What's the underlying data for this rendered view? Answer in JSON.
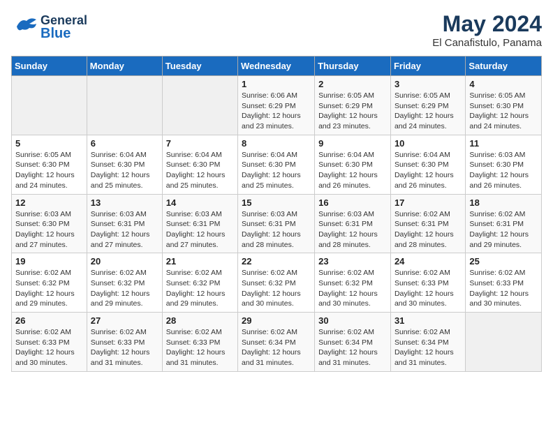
{
  "header": {
    "logo": {
      "line1": "General",
      "line2": "Blue"
    },
    "title": "May 2024",
    "location": "El Canafistulo, Panama"
  },
  "weekdays": [
    "Sunday",
    "Monday",
    "Tuesday",
    "Wednesday",
    "Thursday",
    "Friday",
    "Saturday"
  ],
  "weeks": [
    [
      {
        "day": "",
        "sunrise": "",
        "sunset": "",
        "daylight": ""
      },
      {
        "day": "",
        "sunrise": "",
        "sunset": "",
        "daylight": ""
      },
      {
        "day": "",
        "sunrise": "",
        "sunset": "",
        "daylight": ""
      },
      {
        "day": "1",
        "sunrise": "Sunrise: 6:06 AM",
        "sunset": "Sunset: 6:29 PM",
        "daylight": "Daylight: 12 hours and 23 minutes."
      },
      {
        "day": "2",
        "sunrise": "Sunrise: 6:05 AM",
        "sunset": "Sunset: 6:29 PM",
        "daylight": "Daylight: 12 hours and 23 minutes."
      },
      {
        "day": "3",
        "sunrise": "Sunrise: 6:05 AM",
        "sunset": "Sunset: 6:29 PM",
        "daylight": "Daylight: 12 hours and 24 minutes."
      },
      {
        "day": "4",
        "sunrise": "Sunrise: 6:05 AM",
        "sunset": "Sunset: 6:30 PM",
        "daylight": "Daylight: 12 hours and 24 minutes."
      }
    ],
    [
      {
        "day": "5",
        "sunrise": "Sunrise: 6:05 AM",
        "sunset": "Sunset: 6:30 PM",
        "daylight": "Daylight: 12 hours and 24 minutes."
      },
      {
        "day": "6",
        "sunrise": "Sunrise: 6:04 AM",
        "sunset": "Sunset: 6:30 PM",
        "daylight": "Daylight: 12 hours and 25 minutes."
      },
      {
        "day": "7",
        "sunrise": "Sunrise: 6:04 AM",
        "sunset": "Sunset: 6:30 PM",
        "daylight": "Daylight: 12 hours and 25 minutes."
      },
      {
        "day": "8",
        "sunrise": "Sunrise: 6:04 AM",
        "sunset": "Sunset: 6:30 PM",
        "daylight": "Daylight: 12 hours and 25 minutes."
      },
      {
        "day": "9",
        "sunrise": "Sunrise: 6:04 AM",
        "sunset": "Sunset: 6:30 PM",
        "daylight": "Daylight: 12 hours and 26 minutes."
      },
      {
        "day": "10",
        "sunrise": "Sunrise: 6:04 AM",
        "sunset": "Sunset: 6:30 PM",
        "daylight": "Daylight: 12 hours and 26 minutes."
      },
      {
        "day": "11",
        "sunrise": "Sunrise: 6:03 AM",
        "sunset": "Sunset: 6:30 PM",
        "daylight": "Daylight: 12 hours and 26 minutes."
      }
    ],
    [
      {
        "day": "12",
        "sunrise": "Sunrise: 6:03 AM",
        "sunset": "Sunset: 6:30 PM",
        "daylight": "Daylight: 12 hours and 27 minutes."
      },
      {
        "day": "13",
        "sunrise": "Sunrise: 6:03 AM",
        "sunset": "Sunset: 6:31 PM",
        "daylight": "Daylight: 12 hours and 27 minutes."
      },
      {
        "day": "14",
        "sunrise": "Sunrise: 6:03 AM",
        "sunset": "Sunset: 6:31 PM",
        "daylight": "Daylight: 12 hours and 27 minutes."
      },
      {
        "day": "15",
        "sunrise": "Sunrise: 6:03 AM",
        "sunset": "Sunset: 6:31 PM",
        "daylight": "Daylight: 12 hours and 28 minutes."
      },
      {
        "day": "16",
        "sunrise": "Sunrise: 6:03 AM",
        "sunset": "Sunset: 6:31 PM",
        "daylight": "Daylight: 12 hours and 28 minutes."
      },
      {
        "day": "17",
        "sunrise": "Sunrise: 6:02 AM",
        "sunset": "Sunset: 6:31 PM",
        "daylight": "Daylight: 12 hours and 28 minutes."
      },
      {
        "day": "18",
        "sunrise": "Sunrise: 6:02 AM",
        "sunset": "Sunset: 6:31 PM",
        "daylight": "Daylight: 12 hours and 29 minutes."
      }
    ],
    [
      {
        "day": "19",
        "sunrise": "Sunrise: 6:02 AM",
        "sunset": "Sunset: 6:32 PM",
        "daylight": "Daylight: 12 hours and 29 minutes."
      },
      {
        "day": "20",
        "sunrise": "Sunrise: 6:02 AM",
        "sunset": "Sunset: 6:32 PM",
        "daylight": "Daylight: 12 hours and 29 minutes."
      },
      {
        "day": "21",
        "sunrise": "Sunrise: 6:02 AM",
        "sunset": "Sunset: 6:32 PM",
        "daylight": "Daylight: 12 hours and 29 minutes."
      },
      {
        "day": "22",
        "sunrise": "Sunrise: 6:02 AM",
        "sunset": "Sunset: 6:32 PM",
        "daylight": "Daylight: 12 hours and 30 minutes."
      },
      {
        "day": "23",
        "sunrise": "Sunrise: 6:02 AM",
        "sunset": "Sunset: 6:32 PM",
        "daylight": "Daylight: 12 hours and 30 minutes."
      },
      {
        "day": "24",
        "sunrise": "Sunrise: 6:02 AM",
        "sunset": "Sunset: 6:33 PM",
        "daylight": "Daylight: 12 hours and 30 minutes."
      },
      {
        "day": "25",
        "sunrise": "Sunrise: 6:02 AM",
        "sunset": "Sunset: 6:33 PM",
        "daylight": "Daylight: 12 hours and 30 minutes."
      }
    ],
    [
      {
        "day": "26",
        "sunrise": "Sunrise: 6:02 AM",
        "sunset": "Sunset: 6:33 PM",
        "daylight": "Daylight: 12 hours and 30 minutes."
      },
      {
        "day": "27",
        "sunrise": "Sunrise: 6:02 AM",
        "sunset": "Sunset: 6:33 PM",
        "daylight": "Daylight: 12 hours and 31 minutes."
      },
      {
        "day": "28",
        "sunrise": "Sunrise: 6:02 AM",
        "sunset": "Sunset: 6:33 PM",
        "daylight": "Daylight: 12 hours and 31 minutes."
      },
      {
        "day": "29",
        "sunrise": "Sunrise: 6:02 AM",
        "sunset": "Sunset: 6:34 PM",
        "daylight": "Daylight: 12 hours and 31 minutes."
      },
      {
        "day": "30",
        "sunrise": "Sunrise: 6:02 AM",
        "sunset": "Sunset: 6:34 PM",
        "daylight": "Daylight: 12 hours and 31 minutes."
      },
      {
        "day": "31",
        "sunrise": "Sunrise: 6:02 AM",
        "sunset": "Sunset: 6:34 PM",
        "daylight": "Daylight: 12 hours and 31 minutes."
      },
      {
        "day": "",
        "sunrise": "",
        "sunset": "",
        "daylight": ""
      }
    ]
  ]
}
